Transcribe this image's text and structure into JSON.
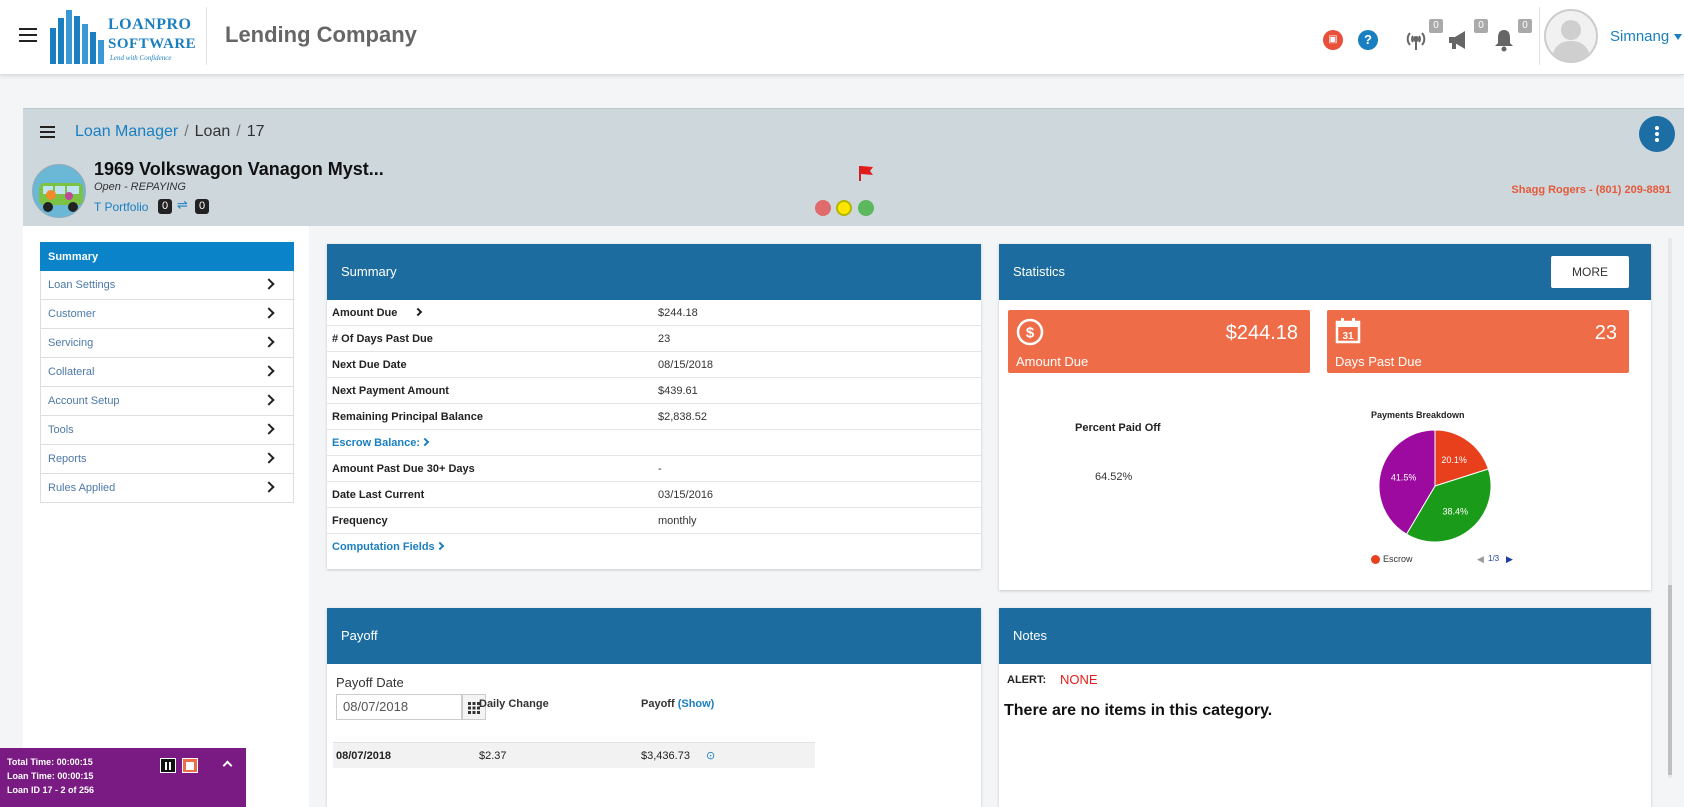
{
  "header": {
    "logo_line1": "LOANPRO",
    "logo_line2": "SOFTWARE",
    "logo_tagline": "Lend with Confidence",
    "company": "Lending Company",
    "badge_count": "0",
    "username": "Simnang"
  },
  "loan": {
    "breadcrumb": [
      "Loan Manager",
      "Loan",
      "17"
    ],
    "title": "1969 Volkswagon Vanagon Myst...",
    "status": "Open - REPAYING",
    "portfolio": "T Portfolio",
    "portfolio_count_a": "0",
    "portfolio_count_b": "0",
    "contact": "Shagg Rogers - (801) 209-8891",
    "status_dots": [
      "#e06b6b",
      "#ffe600",
      "#5cb85c"
    ]
  },
  "sidebar": {
    "items": [
      {
        "label": "Summary",
        "active": true
      },
      {
        "label": "Loan Settings"
      },
      {
        "label": "Customer"
      },
      {
        "label": "Servicing"
      },
      {
        "label": "Collateral"
      },
      {
        "label": "Account Setup"
      },
      {
        "label": "Tools"
      },
      {
        "label": "Reports"
      },
      {
        "label": "Rules Applied"
      }
    ]
  },
  "summary": {
    "title": "Summary",
    "rows": [
      {
        "label": "Amount Due",
        "value": "$244.18"
      },
      {
        "label": "# Of Days Past Due",
        "value": "23"
      },
      {
        "label": "Next Due Date",
        "value": "08/15/2018"
      },
      {
        "label": "Next Payment Amount",
        "value": "$439.61"
      },
      {
        "label": "Remaining Principal Balance",
        "value": "$2,838.52"
      },
      {
        "label": "Escrow Balance:",
        "value": ""
      },
      {
        "label": "Amount Past Due 30+ Days",
        "value": "-"
      },
      {
        "label": "Date Last Current",
        "value": "03/15/2016"
      },
      {
        "label": "Frequency",
        "value": "monthly"
      },
      {
        "label": "Computation Fields",
        "value": ""
      }
    ]
  },
  "statistics": {
    "title": "Statistics",
    "more_label": "MORE",
    "amount_due": "$244.18",
    "amount_due_label": "Amount Due",
    "days_past_due": "23",
    "days_past_due_label": "Days Past Due",
    "percent_title": "Percent Paid Off",
    "percent_value": "64.52%",
    "pie_title": "Payments Breakdown",
    "pie": [
      {
        "label": "20.1%",
        "value": 20.1,
        "color": "#e8401c"
      },
      {
        "label": "38.4%",
        "value": 38.4,
        "color": "#1a9c1a"
      },
      {
        "label": "41.5%",
        "value": 41.5,
        "color": "#9c0aa0"
      }
    ],
    "legend_label": "Escrow",
    "legend_color": "#e8401c",
    "pager": "1/3"
  },
  "payoff": {
    "title": "Payoff",
    "date_label": "Payoff Date",
    "date_value": "08/07/2018",
    "col_daily": "Daily Change",
    "col_payoff": "Payoff",
    "show_link": "(Show)",
    "row_date": "08/07/2018",
    "row_daily": "$2.37",
    "row_payoff": "$3,436.73"
  },
  "notes": {
    "title": "Notes",
    "alert_label": "ALERT:",
    "alert_value": "NONE",
    "empty": "There are no items in this category."
  },
  "timer": {
    "total": "Total Time: 00:00:15",
    "loan": "Loan Time: 00:00:15",
    "loan_id": "Loan ID 17 - 2 of 256"
  }
}
